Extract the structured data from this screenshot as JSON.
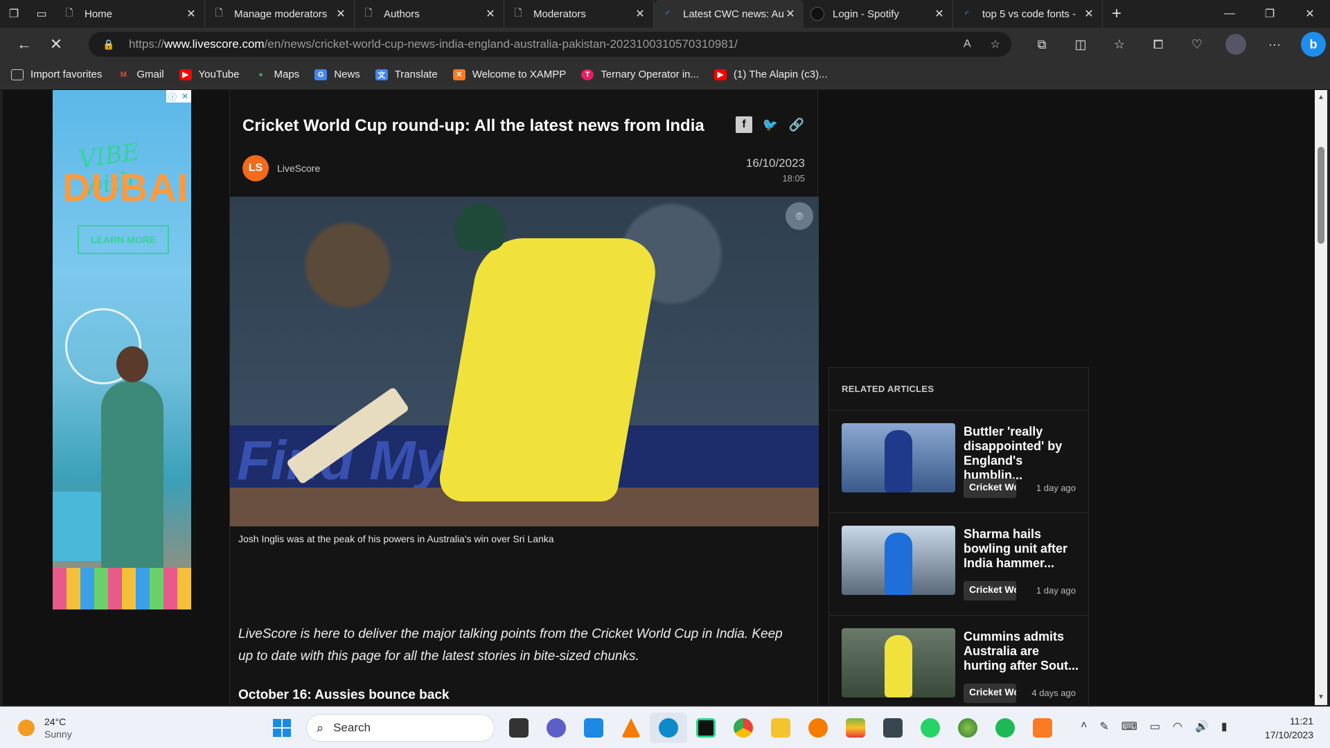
{
  "browser": {
    "tabs": [
      {
        "title": "Home",
        "icon": "page-icon"
      },
      {
        "title": "Manage moderators",
        "icon": "page-icon"
      },
      {
        "title": "Authors",
        "icon": "page-icon"
      },
      {
        "title": "Moderators",
        "icon": "page-icon"
      },
      {
        "title": "Latest CWC news: Au",
        "icon": "loading-icon",
        "active": true
      },
      {
        "title": "Login - Spotify",
        "icon": "spotify-icon"
      },
      {
        "title": "top 5 vs code fonts -",
        "icon": "loading-icon"
      }
    ],
    "url_prefix": "https://",
    "url_domain": "www.livescore.com",
    "url_path": "/en/news/cricket-world-cup-news-india-england-australia-pakistan-2023100310570310981/",
    "favorites": [
      {
        "label": "Import favorites",
        "color": "#cccccc"
      },
      {
        "label": "Gmail",
        "color": "#ea4335"
      },
      {
        "label": "YouTube",
        "color": "#ff0000"
      },
      {
        "label": "Maps",
        "color": "#34a853"
      },
      {
        "label": "News",
        "color": "#4285f4"
      },
      {
        "label": "Translate",
        "color": "#4285f4"
      },
      {
        "label": "Welcome to XAMPP",
        "color": "#fb7a24"
      },
      {
        "label": "Ternary Operator in...",
        "color": "#e91e63"
      },
      {
        "label": "(1) The Alapin (c3)...",
        "color": "#ff0000"
      }
    ]
  },
  "ad": {
    "vibe": "VIBE with",
    "dubai": "DUBAI",
    "cta": "LEARN MORE"
  },
  "article": {
    "title": "Cricket World Cup round-up: All the latest news from India",
    "source": "LiveScore",
    "logo_text": "LS",
    "date": "16/10/2023",
    "time": "18:05",
    "caption": "Josh Inglis was at the peak of his powers in Australia's win over Sri Lanka",
    "intro": "LiveScore is here to deliver the major talking points from the Cricket World Cup in India. Keep up to date with this page for all the latest stories in bite-sized chunks.",
    "subheading": "October 16: Aussies bounce back",
    "hero_board_text": "Find My Flip"
  },
  "related": {
    "heading": "RELATED ARTICLES",
    "items": [
      {
        "title": "Buttler 'really disappointed' by England's humblin...",
        "tag": "Cricket World Cup",
        "time": "1 day ago",
        "shirt": "#1f3a8a"
      },
      {
        "title": "Sharma hails bowling unit after India hammer...",
        "tag": "Cricket World Cup",
        "time": "1 day ago",
        "shirt": "#1e6fd9"
      },
      {
        "title": "Cummins admits Australia are hurting after Sout...",
        "tag": "Cricket World Cup",
        "time": "4 days ago",
        "shirt": "#f0e23a"
      }
    ]
  },
  "taskbar": {
    "temp": "24°C",
    "condition": "Sunny",
    "search": "Search",
    "time": "11:21",
    "date": "17/10/2023",
    "apps": [
      {
        "name": "file-explorer-icon",
        "color": "#333333"
      },
      {
        "name": "teams-icon",
        "color": "#5b5fc7"
      },
      {
        "name": "vscode-icon",
        "color": "#1e88e5"
      },
      {
        "name": "vlc-icon",
        "color": "#f57c00"
      },
      {
        "name": "edge-icon",
        "color": "#0c8ac9"
      },
      {
        "name": "pycharm-icon",
        "color": "#21d789"
      },
      {
        "name": "chrome-icon",
        "color": "#34a853"
      },
      {
        "name": "folder-icon",
        "color": "#f4c430"
      },
      {
        "name": "magnifier-app-icon",
        "color": "#f57c00"
      },
      {
        "name": "bluestacks-icon",
        "color": "#7cb342"
      },
      {
        "name": "calculator-icon",
        "color": "#37474f"
      },
      {
        "name": "whatsapp-icon",
        "color": "#25d366"
      },
      {
        "name": "globe-app-icon",
        "color": "#4caf50"
      },
      {
        "name": "spotify-icon",
        "color": "#1db954"
      },
      {
        "name": "xampp-icon",
        "color": "#fb7a24"
      }
    ]
  }
}
